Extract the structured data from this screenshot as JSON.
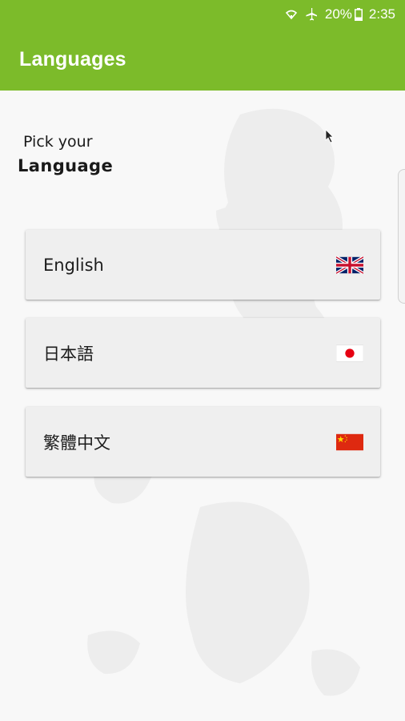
{
  "status_bar": {
    "battery_percent": "20%",
    "time": "2:35",
    "icons": [
      "wifi-icon",
      "airplane-mode-icon",
      "battery-icon"
    ]
  },
  "app_bar": {
    "title": "Languages",
    "color": "#7cbb2a"
  },
  "header": {
    "line1": "Pick your",
    "line2": "Language"
  },
  "languages": [
    {
      "label": "English",
      "flag": "uk-flag-icon"
    },
    {
      "label": "日本語",
      "flag": "japan-flag-icon"
    },
    {
      "label": "繁體中文",
      "flag": "china-flag-icon"
    }
  ]
}
